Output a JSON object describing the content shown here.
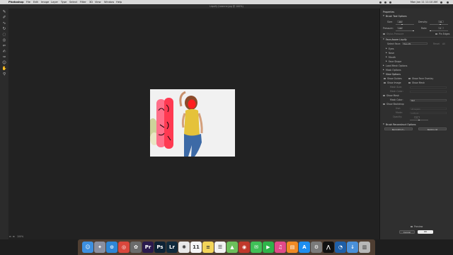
{
  "menubar": {
    "items": [
      "Photoshop",
      "File",
      "Edit",
      "Image",
      "Layer",
      "Type",
      "Select",
      "Filter",
      "3D",
      "View",
      "Window",
      "Help"
    ],
    "clock": "Mon Jan 11  11:10 AM"
  },
  "window": {
    "title": "Liquify (Leanne.jpg @ 100%)"
  },
  "toolbox": {
    "tools": [
      "forward-warp-tool",
      "reconstruct-tool",
      "smooth-tool",
      "twirl-clockwise-tool",
      "pucker-tool",
      "bloat-tool",
      "push-left-tool",
      "freeze-mask-tool",
      "thaw-mask-tool",
      "face-tool",
      "hand-tool",
      "zoom-tool"
    ]
  },
  "workspace": {
    "zoom": "100%"
  },
  "properties": {
    "title": "Properties",
    "brush_tool_options": {
      "header": "Brush Tool Options",
      "size_label": "Size:",
      "size_value": "400",
      "density_label": "Density:",
      "density_value": "50",
      "pressure_label": "Pressure:",
      "pressure_value": "100",
      "rate_label": "Rate:",
      "rate_value": "0",
      "stylus_label": "Stylus Pressure",
      "pin_edges_label": "Pin Edges"
    },
    "face_aware": {
      "header": "Face-Aware Liquify",
      "select_face_label": "Select Face:",
      "select_face_value": "Face #1",
      "reset_label": "Reset",
      "all_label": "All",
      "groups": [
        "Eyes",
        "Nose",
        "Mouth",
        "Face Shape"
      ]
    },
    "load_mesh_header": "Load Mesh Options",
    "mask_options_header": "Mask Options",
    "view_options": {
      "header": "View Options",
      "show_guides": "Show Guides",
      "show_face_overlay": "Show Face Overlay",
      "show_image": "Show Image",
      "show_mesh": "Show Mesh",
      "mesh_size_label": "Mesh Size:",
      "mesh_color_label": "Mesh Color:"
    },
    "show_mask": {
      "label": "Show Mask",
      "mask_color_label": "Mask Color:",
      "mask_color_value": "Red"
    },
    "show_backdrop": {
      "label": "Show Backdrop",
      "use_label": "Use:",
      "use_value": "All Layers",
      "mode_label": "Mode:",
      "mode_value": "In Front",
      "opacity_label": "Opacity:",
      "opacity_value": "50"
    },
    "brush_reconstruct": {
      "header": "Brush Reconstruct Options",
      "reconstruct_btn": "Reconstruct...",
      "restore_all_btn": "Restore All"
    },
    "preview_label": "Preview",
    "cancel_label": "Cancel",
    "ok_label": "OK"
  },
  "dock": {
    "apps": [
      {
        "name": "Finder",
        "glyph": "☺",
        "color": "#3d8fe0"
      },
      {
        "name": "Launchpad",
        "glyph": "✦",
        "color": "#8a8fa0"
      },
      {
        "name": "Safari",
        "glyph": "⊙",
        "color": "#2e86d6"
      },
      {
        "name": "Chrome",
        "glyph": "◎",
        "color": "#d9473c"
      },
      {
        "name": "Settings",
        "glyph": "✿",
        "color": "#6b6b6b"
      },
      {
        "name": "Premiere Pro",
        "glyph": "Pr",
        "color": "#2a1a4d"
      },
      {
        "name": "Photoshop",
        "glyph": "Ps",
        "color": "#0d2235"
      },
      {
        "name": "Lightroom",
        "glyph": "Lr",
        "color": "#102a3c"
      },
      {
        "name": "Photos",
        "glyph": "✺",
        "color": "#e8e8e8"
      },
      {
        "name": "Calendar",
        "glyph": "11",
        "color": "#f5f5f5"
      },
      {
        "name": "Notes",
        "glyph": "≡",
        "color": "#f3d55a"
      },
      {
        "name": "Reminders",
        "glyph": "☰",
        "color": "#f2f2f2"
      },
      {
        "name": "Maps",
        "glyph": "▲",
        "color": "#6cbf5b"
      },
      {
        "name": "Photo Booth",
        "glyph": "◉",
        "color": "#c0392b"
      },
      {
        "name": "Messages",
        "glyph": "✉",
        "color": "#40c057"
      },
      {
        "name": "FaceTime",
        "glyph": "▶",
        "color": "#2fb34a"
      },
      {
        "name": "iTunes",
        "glyph": "♫",
        "color": "#e24a8a"
      },
      {
        "name": "Books",
        "glyph": "▤",
        "color": "#f08a24"
      },
      {
        "name": "App Store",
        "glyph": "A",
        "color": "#1e8ef0"
      },
      {
        "name": "System Preferences",
        "glyph": "⚙",
        "color": "#7a7a7a"
      },
      {
        "name": "Acrobat",
        "glyph": "⋀",
        "color": "#111111"
      },
      {
        "name": "QuickTime",
        "glyph": "◔",
        "color": "#1f5fa8"
      },
      {
        "name": "Downloads",
        "glyph": "↓",
        "color": "#4a90d9"
      },
      {
        "name": "Trash",
        "glyph": "▥",
        "color": "#b8b8b8"
      }
    ]
  },
  "colors": {
    "mask": "#ff2a2a",
    "shirt": "#e5c23a",
    "jeans": "#3d6aa6",
    "panel_bg": "#2f2f2f",
    "ok_button": "#ededed"
  }
}
